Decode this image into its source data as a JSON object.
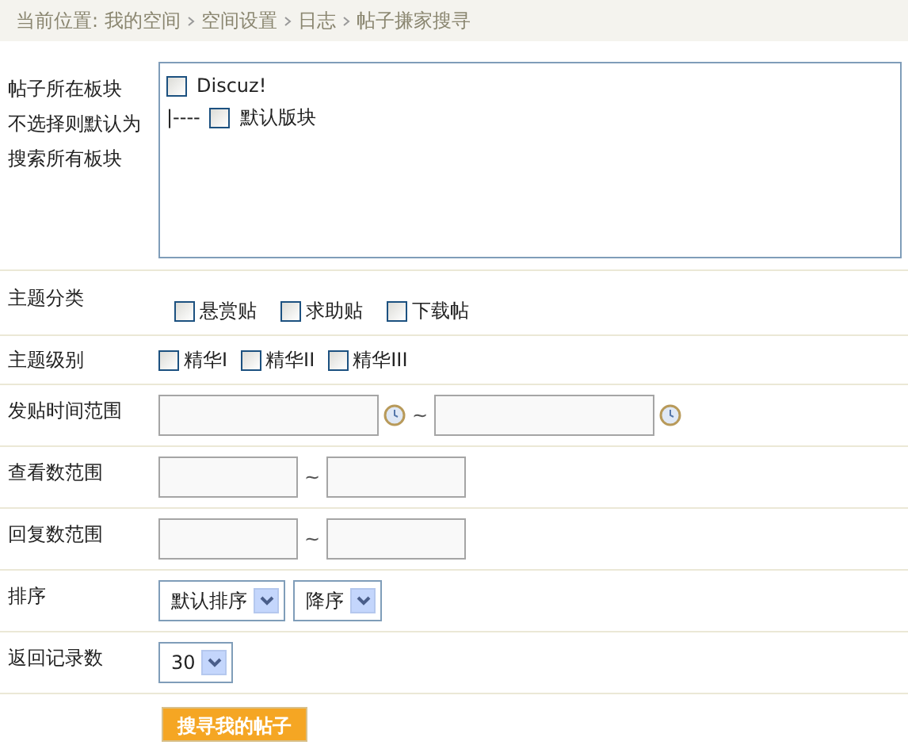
{
  "breadcrumb": {
    "label": "当前位置:",
    "items": [
      "我的空间",
      "空间设置",
      "日志",
      "帖子搛家搜寻"
    ]
  },
  "forum": {
    "label": "帖子所在板块",
    "hint": "不选择则默认为搜索所有板块",
    "tree": [
      {
        "name": "Discuz!",
        "checked": false,
        "children": [
          {
            "prefix": "|----",
            "name": "默认版块",
            "checked": false
          }
        ]
      }
    ]
  },
  "rows": [
    {
      "kind": "checks",
      "label": "主题分类",
      "options": [
        {
          "label": "悬赏贴",
          "checked": false
        },
        {
          "label": "求助贴",
          "checked": false
        },
        {
          "label": "下载帖",
          "checked": false
        }
      ]
    },
    {
      "kind": "checks",
      "label": "主题级别",
      "options": [
        {
          "label": "精华I",
          "checked": false
        },
        {
          "label": "精华II",
          "checked": false
        },
        {
          "label": "精华III",
          "checked": false
        }
      ]
    },
    {
      "kind": "dates",
      "label": "发贴时间范围",
      "separator": "~"
    },
    {
      "kind": "range",
      "label": "查看数范围",
      "separator": "~"
    },
    {
      "kind": "range",
      "label": "回复数范围",
      "separator": "~"
    },
    {
      "kind": "selects",
      "label": "排序",
      "selects": [
        "默认排序",
        "降序"
      ]
    },
    {
      "kind": "selects",
      "label": "返回记录数",
      "selects": [
        "30"
      ]
    }
  ],
  "submit": "搜寻我的帖子"
}
